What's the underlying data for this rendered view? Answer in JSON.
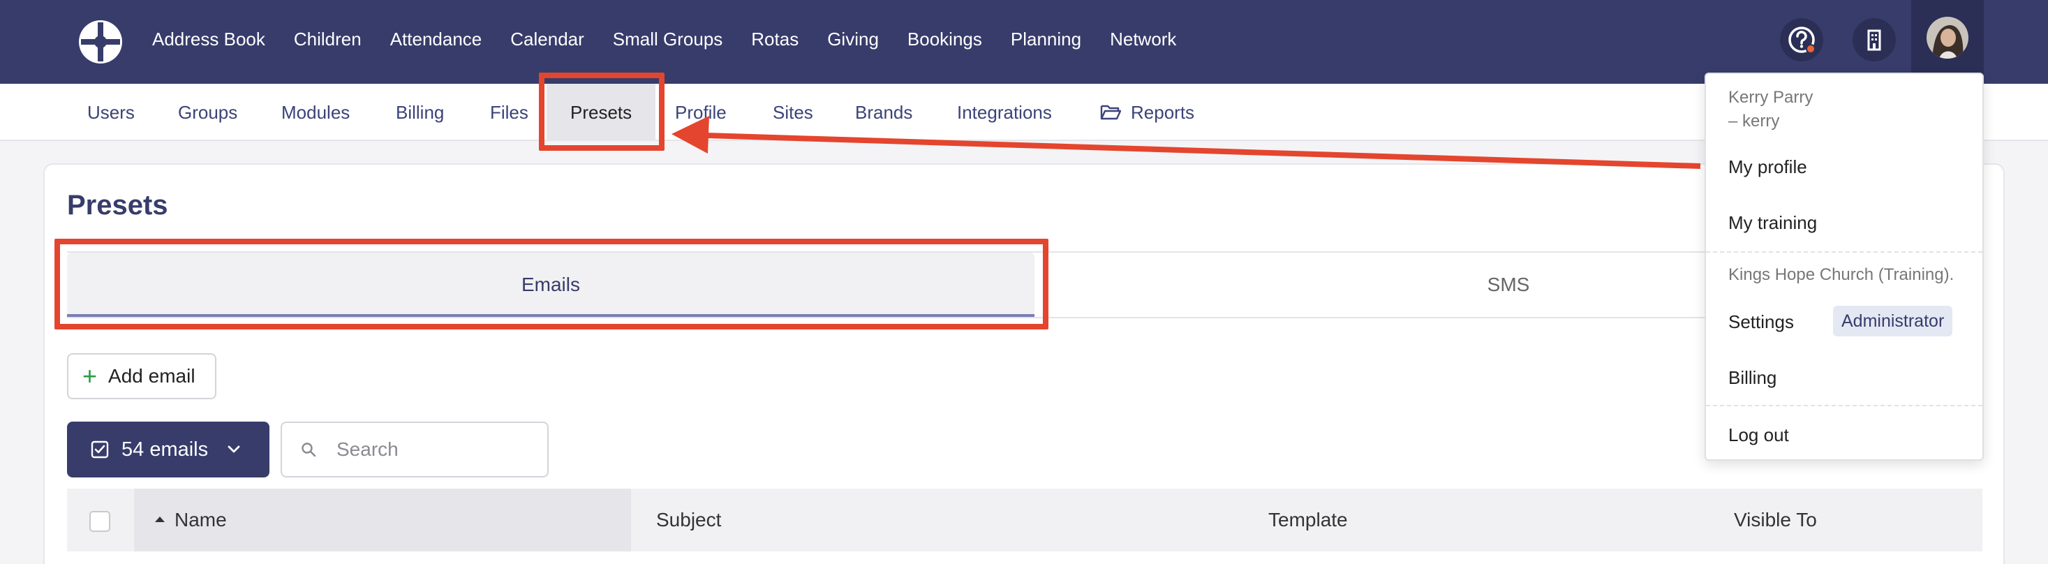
{
  "top_nav": {
    "items": [
      "Address Book",
      "Children",
      "Attendance",
      "Calendar",
      "Small Groups",
      "Rotas",
      "Giving",
      "Bookings",
      "Planning",
      "Network"
    ]
  },
  "sub_nav": {
    "items": [
      "Users",
      "Groups",
      "Modules",
      "Billing",
      "Files",
      "Presets",
      "Profile",
      "Sites",
      "Brands",
      "Integrations",
      "Reports"
    ],
    "active": "Presets"
  },
  "page": {
    "title": "Presets",
    "tabs": [
      "Emails",
      "SMS"
    ],
    "add_email_label": "Add email",
    "emails_count_label": "54 emails",
    "search_placeholder": "Search",
    "table_columns": [
      "Name",
      "Subject",
      "Template",
      "Visible To"
    ]
  },
  "user_menu": {
    "name": "Kerry Parry",
    "username": "– kerry",
    "my_profile": "My profile",
    "my_training": "My training",
    "organisation": "Kings Hope Church (Training).",
    "settings": "Settings",
    "role_badge": "Administrator",
    "billing": "Billing",
    "log_out": "Log out"
  },
  "colors": {
    "nav_bg": "#373c6b",
    "accent": "#373c6b",
    "annotation": "#e4452e",
    "plus_green": "#2f9a48"
  }
}
